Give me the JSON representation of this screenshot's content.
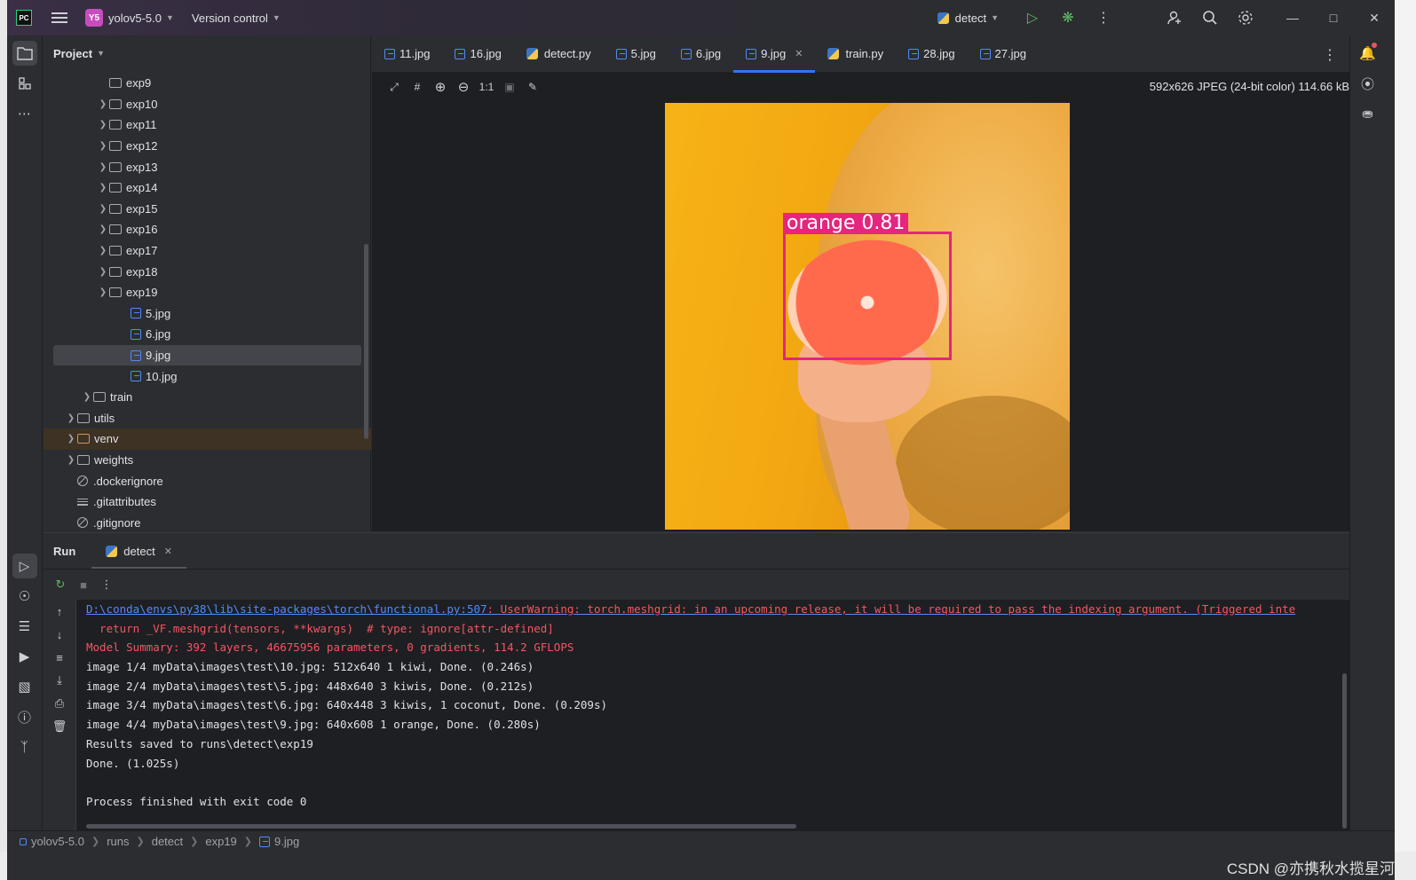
{
  "titlebar": {
    "logo": "PC",
    "project_badge": "Y5",
    "project_name": "yolov5-5.0",
    "version_control": "Version control",
    "run_config": "detect",
    "icons": [
      "run-icon",
      "debug-icon",
      "more-icon",
      "add-user-icon",
      "search-icon",
      "settings-icon",
      "minimize-icon",
      "maximize-icon",
      "close-icon"
    ]
  },
  "project_panel": {
    "title": "Project",
    "tree": [
      {
        "label": "exp9",
        "type": "folder",
        "expanded": false
      },
      {
        "label": "exp10",
        "type": "folder",
        "expanded": false
      },
      {
        "label": "exp11",
        "type": "folder",
        "expanded": false
      },
      {
        "label": "exp12",
        "type": "folder",
        "expanded": false
      },
      {
        "label": "exp13",
        "type": "folder",
        "expanded": false
      },
      {
        "label": "exp14",
        "type": "folder",
        "expanded": false
      },
      {
        "label": "exp15",
        "type": "folder",
        "expanded": false
      },
      {
        "label": "exp16",
        "type": "folder",
        "expanded": false
      },
      {
        "label": "exp17",
        "type": "folder",
        "expanded": false
      },
      {
        "label": "exp18",
        "type": "folder",
        "expanded": false
      },
      {
        "label": "exp19",
        "type": "folder",
        "expanded": true
      },
      {
        "label": "5.jpg",
        "type": "image"
      },
      {
        "label": "6.jpg",
        "type": "image"
      },
      {
        "label": "9.jpg",
        "type": "image",
        "selected": true
      },
      {
        "label": "10.jpg",
        "type": "image"
      },
      {
        "label": "train",
        "type": "folder",
        "expanded": false
      },
      {
        "label": "utils",
        "type": "package",
        "expanded": false
      },
      {
        "label": "venv",
        "type": "folder-excluded",
        "expanded": false
      },
      {
        "label": "weights",
        "type": "folder",
        "expanded": false
      },
      {
        "label": ".dockerignore",
        "type": "ignore"
      },
      {
        "label": ".gitattributes",
        "type": "text"
      },
      {
        "label": ".gitignore",
        "type": "ignore"
      }
    ]
  },
  "editor": {
    "tabs": [
      {
        "label": "11.jpg",
        "type": "image"
      },
      {
        "label": "16.jpg",
        "type": "image"
      },
      {
        "label": "detect.py",
        "type": "python"
      },
      {
        "label": "5.jpg",
        "type": "image"
      },
      {
        "label": "6.jpg",
        "type": "image"
      },
      {
        "label": "9.jpg",
        "type": "image",
        "active": true
      },
      {
        "label": "train.py",
        "type": "python"
      },
      {
        "label": "28.jpg",
        "type": "image"
      },
      {
        "label": "27.jpg",
        "type": "image"
      }
    ],
    "zoom_actual": "1:1",
    "image_info": "592x626 JPEG (24-bit color) 114.66 kB",
    "detection_label": "orange 0.81",
    "detection_color": "#e5257e"
  },
  "run_panel": {
    "title": "Run",
    "tab": "detect",
    "console": [
      {
        "text": "D:\\conda\\envs\\py38\\lib\\site-packages\\torch\\functional.py:507",
        "tail": ": UserWarning: torch.meshgrid: in an upcoming release, it will be required to pass the indexing argument. (Triggered inte",
        "kind": "link"
      },
      {
        "text": "  return _VF.meshgrid(tensors, **kwargs)  # type: ignore[attr-defined]",
        "kind": "err"
      },
      {
        "text": "Model Summary: 392 layers, 46675956 parameters, 0 gradients, 114.2 GFLOPS",
        "kind": "err"
      },
      {
        "text": "image 1/4 myData\\images\\test\\10.jpg: 512x640 1 kiwi, Done. (0.246s)",
        "kind": "out"
      },
      {
        "text": "image 2/4 myData\\images\\test\\5.jpg: 448x640 3 kiwis, Done. (0.212s)",
        "kind": "out"
      },
      {
        "text": "image 3/4 myData\\images\\test\\6.jpg: 640x448 3 kiwis, 1 coconut, Done. (0.209s)",
        "kind": "out"
      },
      {
        "text": "image 4/4 myData\\images\\test\\9.jpg: 640x608 1 orange, Done. (0.280s)",
        "kind": "out"
      },
      {
        "text": "Results saved to runs\\detect\\exp19",
        "kind": "out"
      },
      {
        "text": "Done. (1.025s)",
        "kind": "out"
      },
      {
        "text": "",
        "kind": "out"
      },
      {
        "text": "Process finished with exit code 0",
        "kind": "out"
      }
    ]
  },
  "statusbar": {
    "breadcrumbs": [
      "yolov5-5.0",
      "runs",
      "detect",
      "exp19",
      "9.jpg"
    ],
    "watermark": "CSDN @亦携秋水揽星河"
  }
}
